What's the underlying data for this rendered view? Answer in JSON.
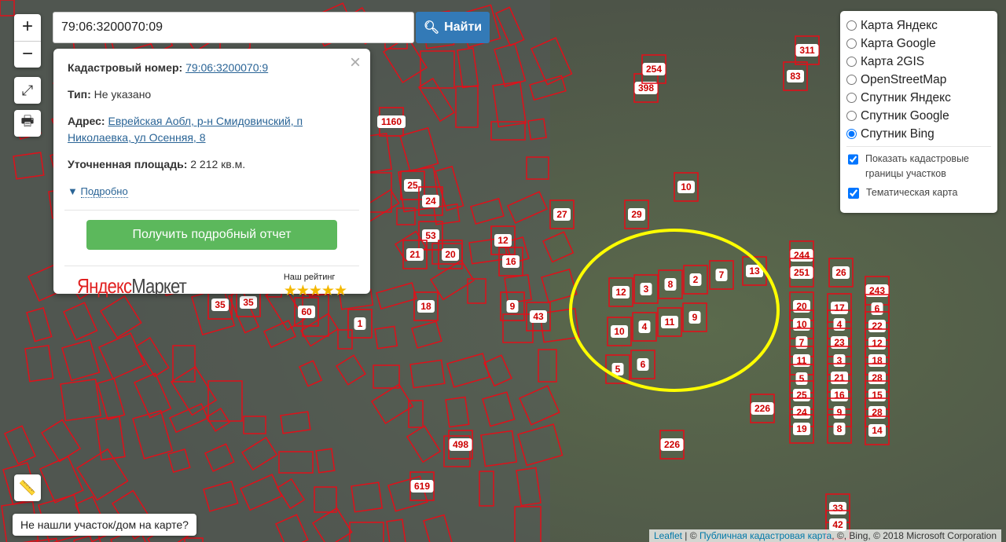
{
  "search": {
    "value": "79:06:3200070:09",
    "button": "Найти"
  },
  "controls": {
    "zoom_in": "+",
    "zoom_out": "−"
  },
  "popup": {
    "cadastral_label": "Кадастровый номер:",
    "cadastral_value": "79:06:3200070:9",
    "type_label": "Тип:",
    "type_value": "Не указано",
    "address_label": "Адрес:",
    "address_value": "Еврейская Аобл, р-н Смидовичский, п Николаевка, ул Осенняя, 8",
    "area_label": "Уточненная площадь:",
    "area_value": "2 212 кв.м.",
    "more": "Подробно",
    "report_button": "Получить подробный отчет",
    "ad_logo_a": "Яндекс",
    "ad_logo_b": "Маркет",
    "rating_label": "Наш рейтинг",
    "rating_stars": 5
  },
  "layers": {
    "base": [
      {
        "label": "Карта Яндекс",
        "checked": false
      },
      {
        "label": "Карта Google",
        "checked": false
      },
      {
        "label": "Карта 2GIS",
        "checked": false
      },
      {
        "label": "OpenStreetMap",
        "checked": false
      },
      {
        "label": "Спутник Яндекс",
        "checked": false
      },
      {
        "label": "Спутник Google",
        "checked": false
      },
      {
        "label": "Спутник Bing",
        "checked": true
      }
    ],
    "overlays": [
      {
        "label": "Показать кадастровые границы участков",
        "checked": true
      },
      {
        "label": "Тематическая карта",
        "checked": true
      }
    ]
  },
  "not_found": "Не нашли участок/дом на карте?",
  "attribution": {
    "leaflet": "Leaflet",
    "sep": " | © ",
    "pkk": "Публичная кадастровая карта",
    "rest": ", ©, Bing, © 2018 Microsoft Corporation"
  },
  "parcels": [
    "12",
    "3",
    "8",
    "2",
    "7",
    "13",
    "10",
    "4",
    "11",
    "9",
    "5",
    "6",
    "244",
    "251",
    "26",
    "20",
    "10",
    "7",
    "11",
    "5",
    "25",
    "24",
    "19",
    "17",
    "4",
    "23",
    "3",
    "21",
    "16",
    "9",
    "8",
    "243",
    "6",
    "22",
    "12",
    "18",
    "28",
    "15",
    "28",
    "14",
    "226",
    "226",
    "33",
    "42",
    "1160",
    "27",
    "29",
    "10",
    "398",
    "254",
    "311",
    "83",
    "498",
    "619",
    "25",
    "24",
    "53",
    "21",
    "20",
    "16",
    "12",
    "9",
    "43",
    "60",
    "35",
    "35",
    "1",
    "18"
  ],
  "colors": {
    "parcel": "#e0101a",
    "highlight": "#ffff00",
    "map_bg": "#4a5246"
  }
}
